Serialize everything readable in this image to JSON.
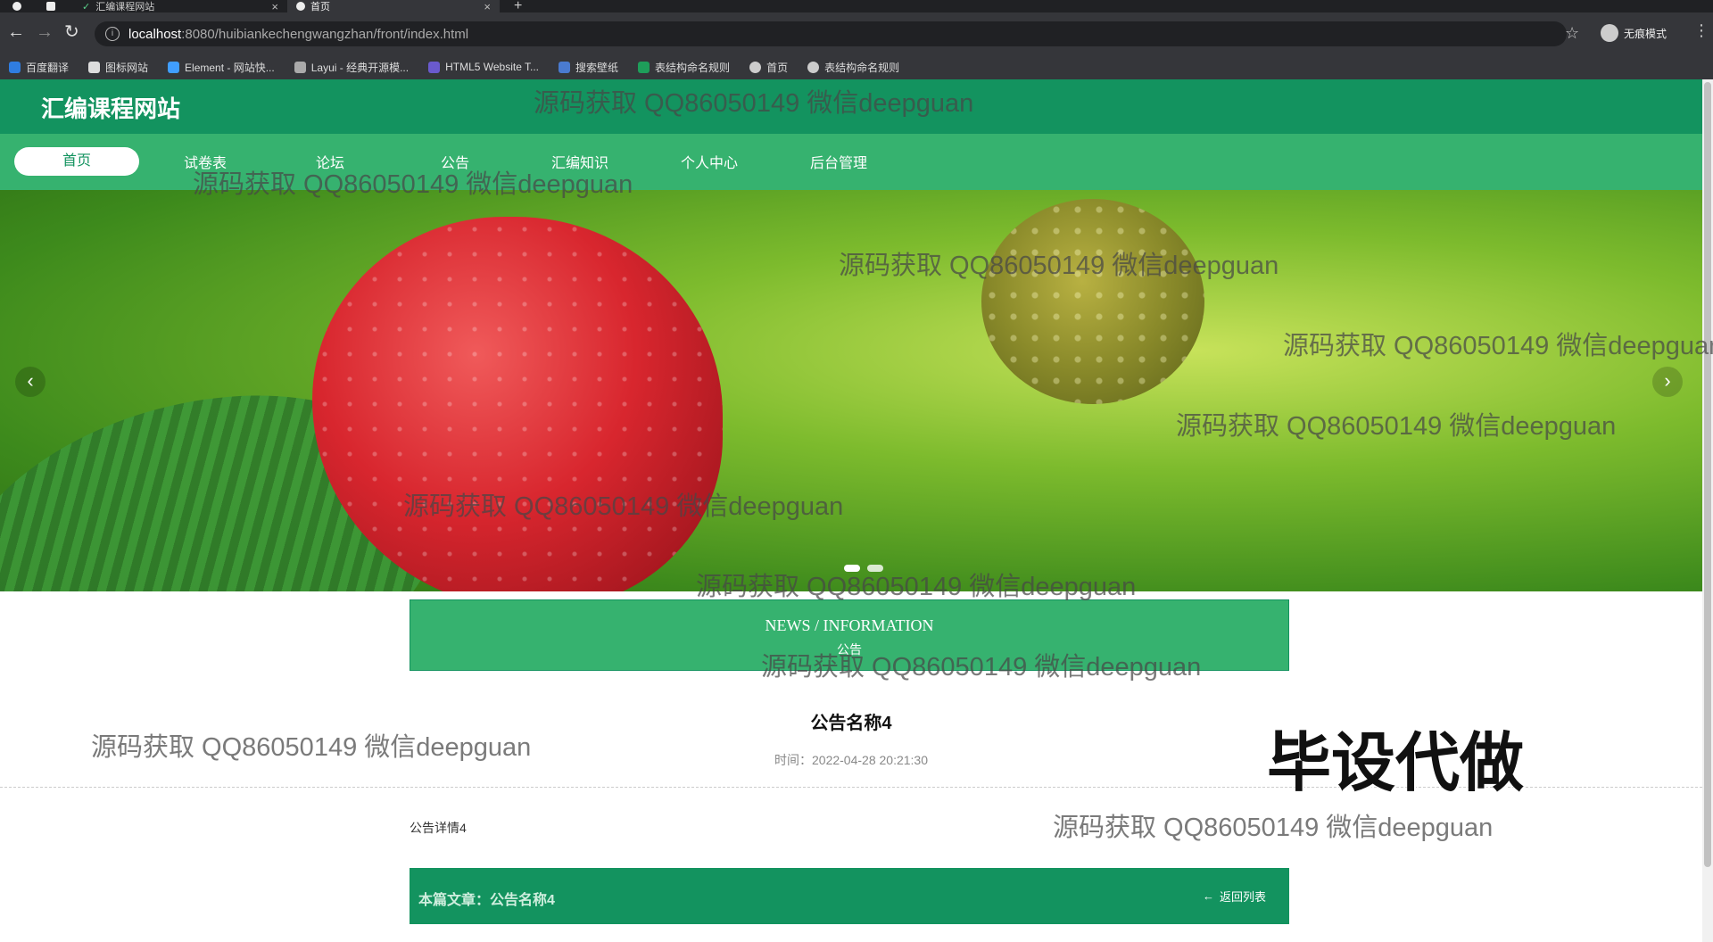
{
  "browser": {
    "tabs": [
      {
        "title": "汇编课程网站"
      },
      {
        "title": "首页"
      }
    ],
    "url_host": "localhost",
    "url_rest": ":8080/huibiankechengwangzhan/front/index.html",
    "profile_label": "无痕模式",
    "bookmarks": [
      "百度翻译",
      "图标网站",
      "Element - 网站快...",
      "Layui - 经典开源模...",
      "HTML5 Website T...",
      "搜索壁纸",
      "表结构命名规则",
      "首页",
      "表结构命名规则"
    ]
  },
  "site": {
    "title": "汇编课程网站",
    "nav": [
      "首页",
      "试卷表",
      "论坛",
      "公告",
      "汇编知识",
      "个人中心",
      "后台管理"
    ],
    "active_nav": "首页"
  },
  "news_header": {
    "en": "NEWS / INFORMATION",
    "cn": "公告"
  },
  "article": {
    "title": "公告名称4",
    "time_label": "时间：",
    "time_value": "2022-04-28 20:21:30",
    "body": "公告详情4"
  },
  "footer": {
    "current_label": "本篇文章：",
    "current_value": "公告名称4",
    "back_label": "返回列表"
  },
  "watermark_text": "源码获取 QQ86050149 微信deepguan",
  "stamp_text": "毕设代做",
  "colors": {
    "header": "#13935f",
    "nav": "#36b26f",
    "accent": "#13935f"
  }
}
